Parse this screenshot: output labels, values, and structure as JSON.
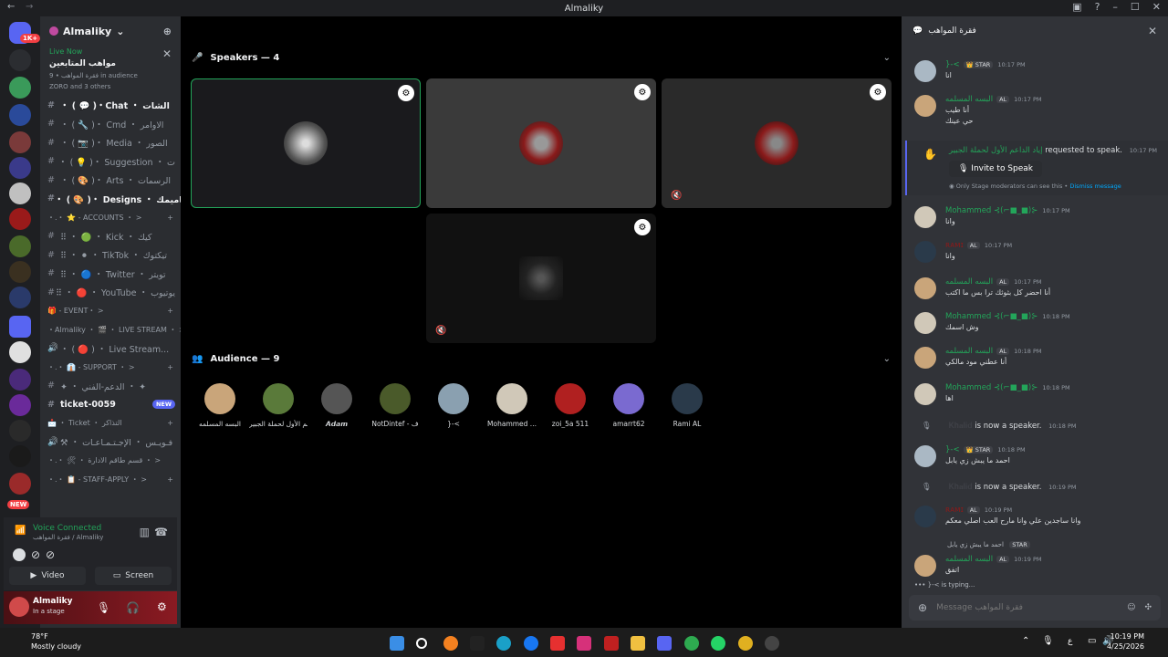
{
  "window": {
    "title": "Almaliky"
  },
  "server": {
    "name": "Almaliky"
  },
  "live": {
    "badge": "Live Now",
    "title": "مواهب المتابعين",
    "subtitle": "فقرة المواهب • 9 in audience",
    "people": "ZORO and 3 others"
  },
  "channels": [
    {
      "label": "・ ( 💬 )・Chat ・ الشات",
      "bold": true
    },
    {
      "label": "・ ( 🔧 )・ Cmd ・ الاوامر",
      "bold": false
    },
    {
      "label": "・ ( 📷 )・ Media ・ الصور",
      "bold": false
    },
    {
      "label": "・ ( 💡 )・ Suggestion ・ ت",
      "bold": false
    },
    {
      "label": "・ ( 🎨 )・ Arts ・ الرسمات",
      "bold": false
    },
    {
      "label": "・ ( 🎨 )・ Designs ・ تصاميمك",
      "bold": true
    }
  ],
  "categories": {
    "accounts": "・.・ ⭐ - ACCOUNTS ・ >",
    "event": "🎁 - EVENT・ >",
    "stream": "・Almaliky ・ 🎬 ・ LIVE STREAM ・ >",
    "support": "・.・ 👔 - SUPPORT ・ >",
    "ticket": "📩 ・ Ticket ・ التذاكر",
    "admin": "・.・ 🛠 ・ قسم طاقم الادارة ・ >",
    "staff": "・.・ 📋 - STAFF-APPLY ・ >"
  },
  "accountChannels": [
    {
      "label": "⠿ ・ 🟢 ・ Kick ・ كيك"
    },
    {
      "label": "⠿ ・ ⚫ ・ TikTok ・ تيكتوك"
    },
    {
      "label": "⠿ ・ 🔵 ・ Twitter ・ تويتر"
    },
    {
      "label": "⠿ ・ 🔴 ・ YouTube ・ يوتيوب"
    }
  ],
  "streamChannel": "・ ( 🔴 ) ・ Live Stream...",
  "supportChannel": "✦ ・ الدعم-الفني ・ ✦",
  "ticketChannel": "ticket-0059",
  "newBadge": "NEW",
  "meetingsChannel": "⚒ ・ فـويـس ・ الإجـتـمـاعـات",
  "voice": {
    "status": "Voice Connected",
    "channel": "فقرة المواهب / Almaliky",
    "video": "Video",
    "screen": "Screen"
  },
  "user": {
    "name": "Almaliky",
    "status": "In a stage"
  },
  "stage": {
    "speakers_label": "Speakers — 4",
    "audience_label": "Audience — 9",
    "audience": [
      {
        "name": "البسه المسلمه",
        "color": "#c9a57a"
      },
      {
        "name": "إياد الداعم الأول لحملة الجبير",
        "color": "#5a7a3a"
      },
      {
        "name": "𝘼𝙙𝙖𝙢",
        "color": "#555"
      },
      {
        "name": "NotDintef - ف",
        "color": "#4a5a2a"
      },
      {
        "name": "}-<",
        "color": "#8aa0b0"
      },
      {
        "name": "Mohammed ...",
        "color": "#d0c8b8"
      },
      {
        "name": "zoi_5a 511",
        "color": "#b02020"
      },
      {
        "name": "amarrt62",
        "color": "#7a6ad0"
      },
      {
        "name": "Rami AL",
        "color": "#2a3a4a"
      }
    ]
  },
  "chat": {
    "header": "فقرة المواهب",
    "messages": [
      {
        "name": "}-<",
        "tag": "👑 STAR",
        "time": "10:17 PM",
        "text": "انا",
        "nameColor": "#23a55a",
        "av": "#aab8c4"
      },
      {
        "name": "البسه المسلمه",
        "tag": "AL",
        "time": "10:17 PM",
        "text": "أنا طيب",
        "nameColor": "#23a55a",
        "av": "#c9a57a"
      },
      {
        "name": "",
        "tag": "",
        "time": "",
        "text": "حي عينك",
        "nameColor": "#23a55a",
        "av": ""
      },
      {
        "name": "Mohammed ⊰(⌐■_■)⊱",
        "tag": "",
        "time": "10:17 PM",
        "text": "وانا",
        "nameColor": "#23a55a",
        "av": "#d0c8b8"
      },
      {
        "name": "ʀᴀᴍɪ",
        "tag": "AL",
        "time": "10:17 PM",
        "text": "وانا",
        "nameColor": "#8b1a1a",
        "av": "#2a3a4a"
      },
      {
        "name": "البسه المسلمه",
        "tag": "AL",
        "time": "10:17 PM",
        "text": "أنا احضر كل بثوثك ترا بس ما اكتب",
        "nameColor": "#23a55a",
        "av": "#c9a57a"
      },
      {
        "name": "Mohammed ⊰(⌐■_■)⊱",
        "tag": "",
        "time": "10:18 PM",
        "text": "وش اسمك",
        "nameColor": "#23a55a",
        "av": "#d0c8b8"
      },
      {
        "name": "البسه المسلمه",
        "tag": "AL",
        "time": "10:18 PM",
        "text": "أنا عطني مود مالكي",
        "nameColor": "#23a55a",
        "av": "#c9a57a"
      },
      {
        "name": "Mohammed ⊰(⌐■_■)⊱",
        "tag": "",
        "time": "10:18 PM",
        "text": "اها",
        "nameColor": "#23a55a",
        "av": "#d0c8b8"
      },
      {
        "name": "}-<",
        "tag": "👑 STAR",
        "time": "10:18 PM",
        "text": "احمد ما يبش زي يابل",
        "nameColor": "#23a55a",
        "av": "#aab8c4"
      },
      {
        "name": "ʀᴀᴍɪ",
        "tag": "AL",
        "time": "10:19 PM",
        "text": "وانا ساجدين علي وانا مارح العب اصلي معكم",
        "nameColor": "#8b1a1a",
        "av": "#2a3a4a"
      },
      {
        "name": "البسه المسلمه",
        "tag": "AL",
        "time": "10:19 PM",
        "text": "اتفق",
        "nameColor": "#23a55a",
        "av": "#c9a57a"
      }
    ],
    "request": {
      "name": "إياد الداعم الأول لحملة الجبير",
      "suffix": "requested to speak.",
      "time": "10:17 PM",
      "button": "Invite to Speak",
      "note": "Only Stage moderators can see this •",
      "dismiss": "Dismiss message"
    },
    "speaker1": {
      "name": "𝐊𝐡𝐚𝐥𝐢𝐝",
      "suffix": "is now a speaker.",
      "time": "10:18 PM"
    },
    "speaker2": {
      "name": "𝐊𝐡𝐚𝐥𝐢𝐝",
      "suffix": "is now a speaker.",
      "time": "10:19 PM"
    },
    "reply": "احمد ما يبش زي يابل",
    "reply_tag": "STAR",
    "typing": "}-< is typing...",
    "placeholder": "Message فقرة المواهب"
  },
  "taskbar": {
    "temp": "78°F",
    "weather": "Mostly cloudy",
    "time": "10:19 PM",
    "date": "4/25/2026",
    "lang": "ع"
  }
}
